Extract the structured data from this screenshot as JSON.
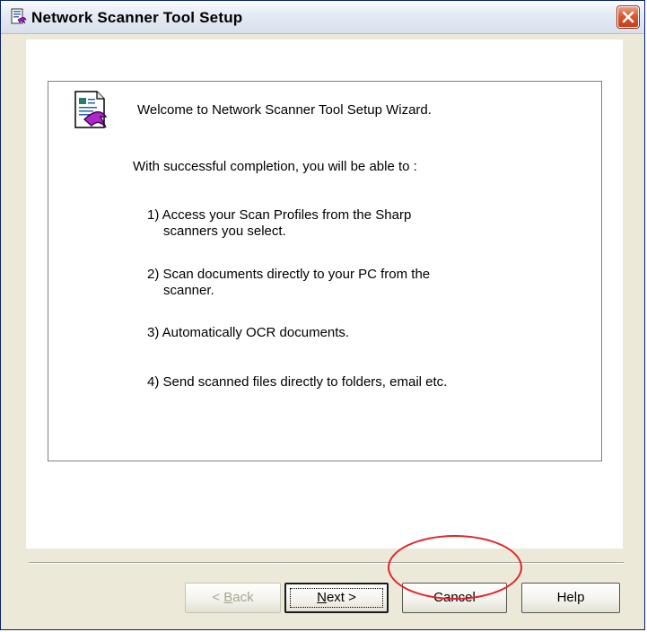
{
  "window": {
    "title": "Network Scanner Tool Setup",
    "close_label": "×"
  },
  "welcome": {
    "heading": "Welcome to Network Scanner Tool Setup Wizard.",
    "intro": "With successful completion, you will be able to :",
    "items": [
      {
        "line1": "1)  Access your Scan Profiles from the Sharp",
        "line2": "scanners you select."
      },
      {
        "line1": "2)  Scan documents directly to your PC from the",
        "line2": "scanner."
      },
      {
        "line1": "3)  Automatically OCR documents.",
        "line2": ""
      },
      {
        "line1": "4)  Send scanned files directly to folders, email etc.",
        "line2": ""
      }
    ]
  },
  "buttons": {
    "back": {
      "prefix": "< ",
      "mnemonic": "B",
      "rest": "ack"
    },
    "next": {
      "mnemonic": "N",
      "rest": "ext >"
    },
    "cancel": "Cancel",
    "help": "Help"
  },
  "colors": {
    "dialog_bg": "#ece9d8",
    "highlight": "#e0242b",
    "close_button": "#d9582e"
  },
  "icons": {
    "app": "setup-wizard-icon",
    "wizard": "document-arrow-icon",
    "close": "close-icon"
  }
}
